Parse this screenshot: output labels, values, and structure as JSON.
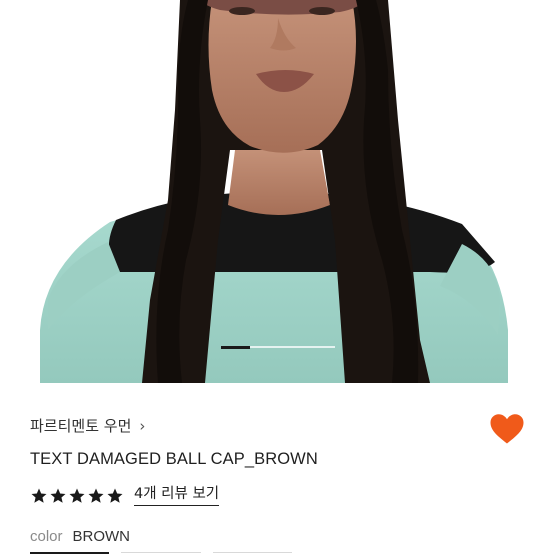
{
  "product": {
    "brand": "파르티멘토 우먼",
    "brand_chevron": "›",
    "name": "TEXT DAMAGED BALL CAP_BROWN",
    "rating": 5,
    "rating_max": 5,
    "review_link": "4개 리뷰 보기",
    "color_label": "color",
    "color_value": "BROWN",
    "wishlisted": true
  },
  "gallery": {
    "progress": 0.25
  },
  "colors": {
    "wish": "#F05A1A",
    "star": "#1a1a1a",
    "top_mint": "#A4D6CB",
    "collar_black": "#161616"
  },
  "icons": {
    "wish": "heart-icon",
    "star": "star-icon",
    "chevron": "chevron-right-icon"
  }
}
